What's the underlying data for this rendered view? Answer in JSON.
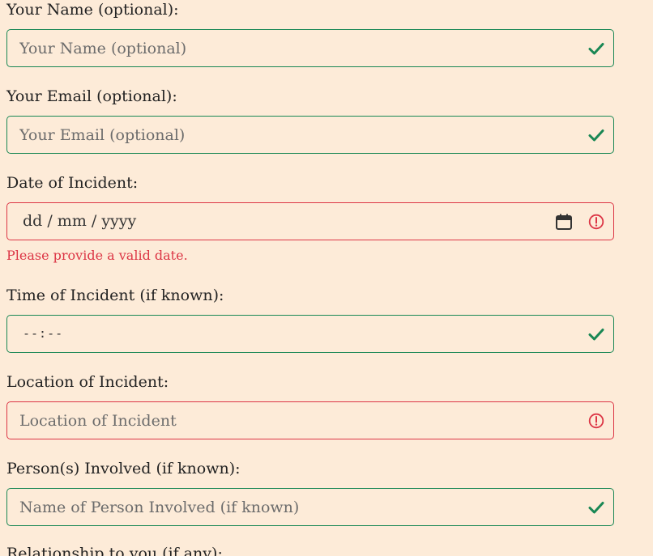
{
  "fields": {
    "name": {
      "label": "Your Name (optional):",
      "placeholder": "Your Name (optional)",
      "status": "valid"
    },
    "email": {
      "label": "Your Email (optional):",
      "placeholder": "Your Email (optional)",
      "status": "valid"
    },
    "date": {
      "label": "Date of Incident:",
      "value_display": "dd / mm / yyyy",
      "status": "invalid",
      "error": "Please provide a valid date."
    },
    "time": {
      "label": "Time of Incident (if known):",
      "value_display": "--:--",
      "status": "valid"
    },
    "location": {
      "label": "Location of Incident:",
      "placeholder": "Location of Incident",
      "status": "invalid"
    },
    "persons": {
      "label": "Person(s) Involved (if known):",
      "placeholder": "Name of Person Involved (if known)",
      "status": "valid"
    },
    "relationship": {
      "label": "Relationship to you (if any):"
    }
  },
  "colors": {
    "background": "#fdebd8",
    "valid": "#198754",
    "invalid": "#dc3545"
  },
  "icons": {
    "valid": "check-icon",
    "invalid": "exclamation-circle-icon",
    "date": "calendar-icon"
  }
}
